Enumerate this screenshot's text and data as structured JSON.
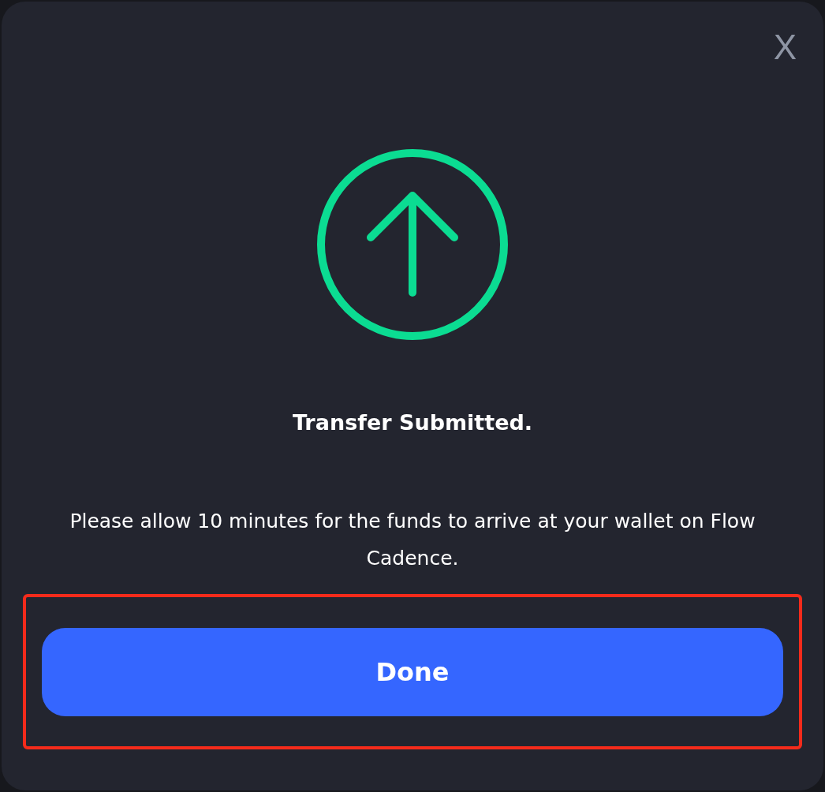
{
  "dialog": {
    "close_label": "X",
    "title": "Transfer Submitted.",
    "message": "Please allow 10 minutes for the funds to arrive at your wallet on Flow Cadence.",
    "done_button": {
      "label": "Done",
      "highlighted": true
    }
  }
}
